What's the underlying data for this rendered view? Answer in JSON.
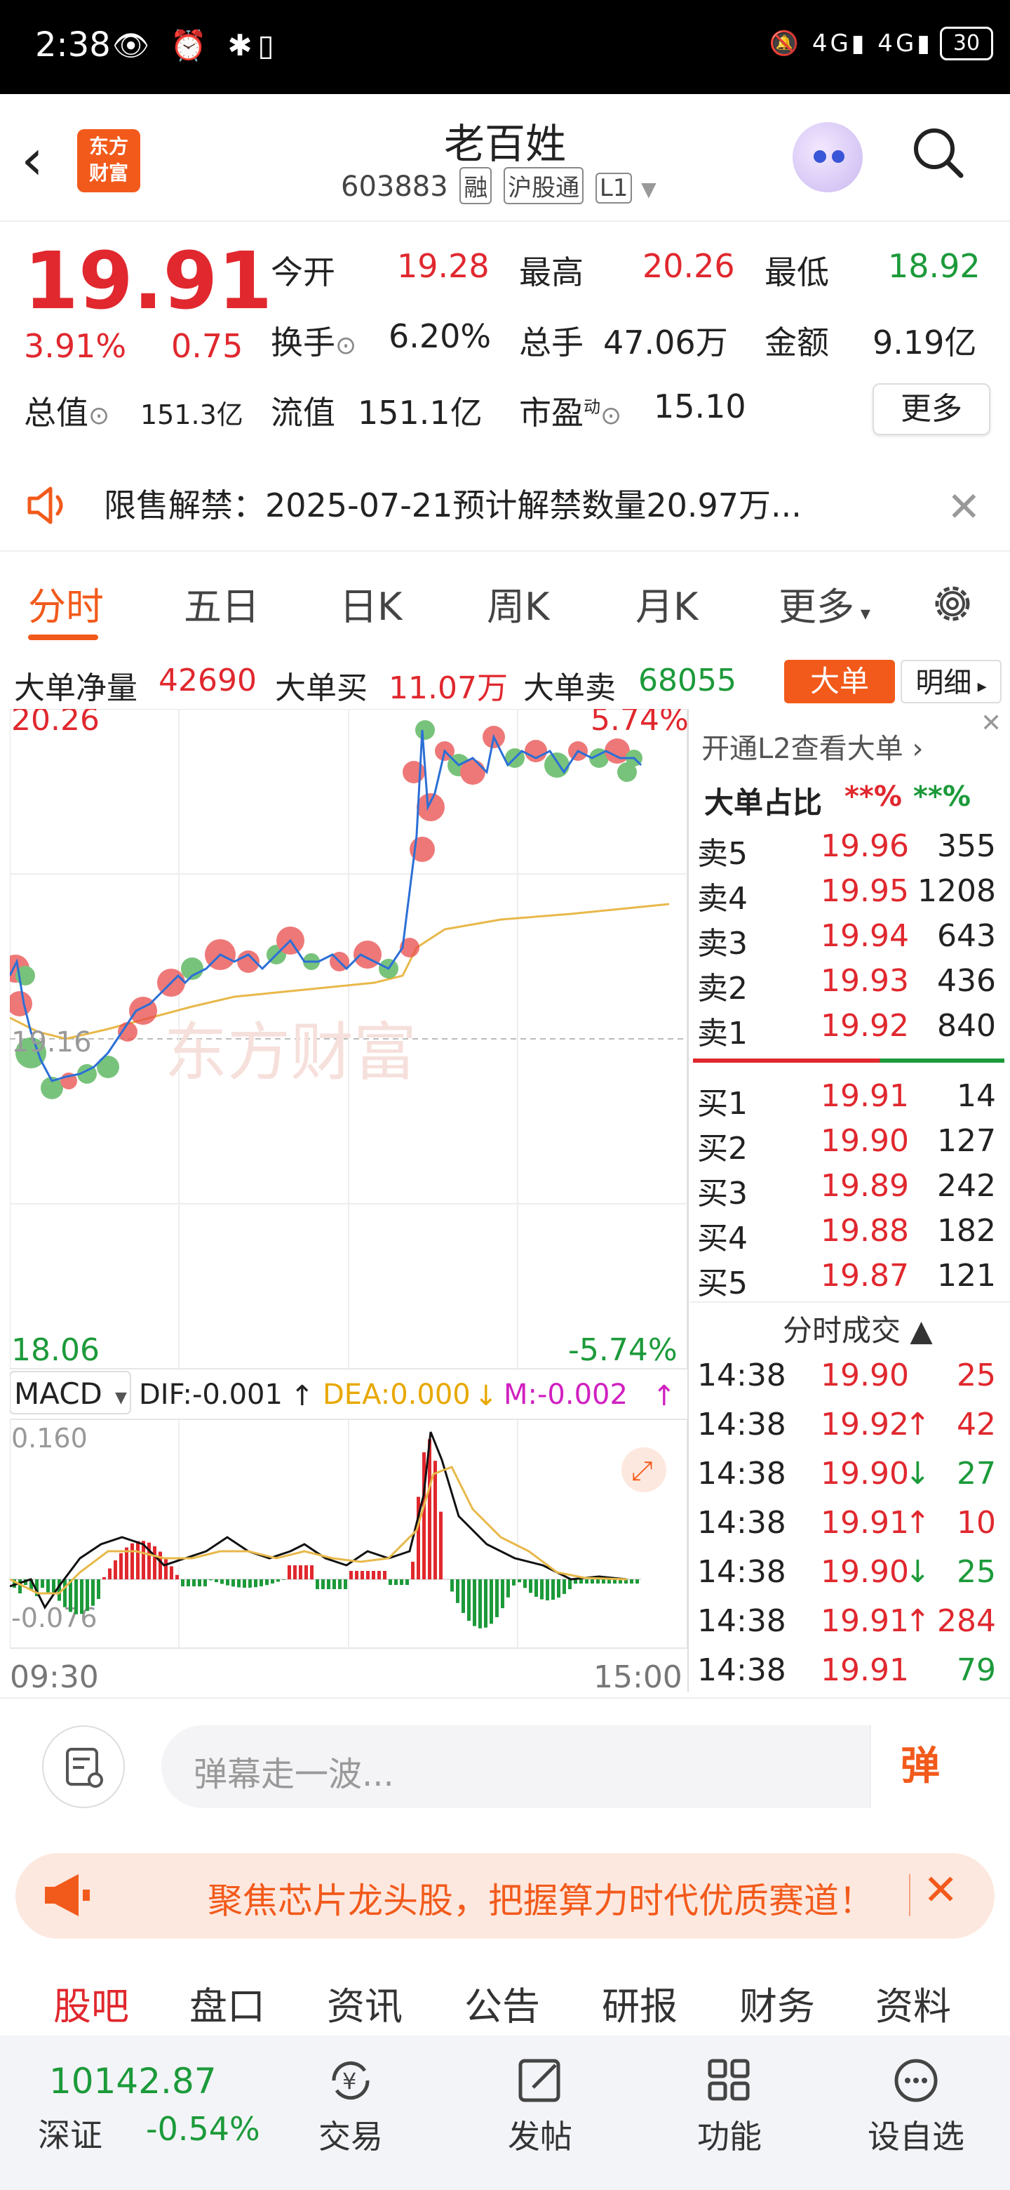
{
  "status_bar": {
    "time": "2:38",
    "left_icons": "👁 ⏰ ✱▯",
    "right_icons": "🔕 4G▮ 4G▮",
    "battery": "30"
  },
  "header": {
    "stock_name": "老百姓",
    "stock_code": "603883",
    "tags": [
      "融",
      "沪股通",
      "L1"
    ],
    "logo_text_line1": "东方",
    "logo_text_line2": "财富"
  },
  "quote": {
    "price": "19.91",
    "change_pct": "3.91%",
    "change": "0.75",
    "open_label": "今开",
    "open": "19.28",
    "high_label": "最高",
    "high": "20.26",
    "low_label": "最低",
    "low": "18.92",
    "turnover_label": "换手",
    "turnover": "6.20%",
    "volume_label": "总手",
    "volume": "47.06万",
    "amount_label": "金额",
    "amount": "9.19亿",
    "total_cap_label": "总值",
    "total_cap": "151.3亿",
    "float_cap_label": "流值",
    "float_cap": "151.1亿",
    "pe_label": "市盈",
    "pe_sup": "动",
    "pe": "15.10",
    "more_label": "更多"
  },
  "notice": {
    "text": "限售解禁：2025-07-21预计解禁数量20.97万..."
  },
  "tabs": [
    "分时",
    "五日",
    "日K",
    "周K",
    "月K",
    "更多"
  ],
  "bigorder": {
    "net_label": "大单净量",
    "net": "42690",
    "buy_label": "大单买",
    "buy": "11.07万",
    "sell_label": "大单卖",
    "sell": "68055",
    "btn_big": "大单",
    "btn_detail": "明细"
  },
  "chart_labels": {
    "top_price": "20.26",
    "top_pct": "5.74%",
    "bottom_price": "18.06",
    "bottom_pct": "-5.74%",
    "mid_price": "19.16",
    "start_time": "09:30",
    "end_time": "15:00",
    "watermark": "东方财富"
  },
  "macd": {
    "name": "MACD",
    "dif": "DIF:-0.001",
    "dea": "DEA:0.000",
    "m": "M:-0.002",
    "top": "0.160",
    "bottom": "-0.076"
  },
  "colors": {
    "accent": "#f25a1b",
    "up": "#e0282e",
    "down": "#1c9a3a",
    "avg_line": "#e8b84a",
    "price_line": "#2b6fd6"
  },
  "orderbook": {
    "l2_link": "开通L2查看大单",
    "ratio_label": "大单占比",
    "ratio_buy": "**%",
    "ratio_sell": "**%",
    "asks": [
      {
        "label": "卖5",
        "price": "19.96",
        "vol": "355"
      },
      {
        "label": "卖4",
        "price": "19.95",
        "vol": "1208"
      },
      {
        "label": "卖3",
        "price": "19.94",
        "vol": "643"
      },
      {
        "label": "卖2",
        "price": "19.93",
        "vol": "436"
      },
      {
        "label": "卖1",
        "price": "19.92",
        "vol": "840"
      }
    ],
    "bids": [
      {
        "label": "买1",
        "price": "19.91",
        "vol": "14"
      },
      {
        "label": "买2",
        "price": "19.90",
        "vol": "127"
      },
      {
        "label": "买3",
        "price": "19.89",
        "vol": "242"
      },
      {
        "label": "买4",
        "price": "19.88",
        "vol": "182"
      },
      {
        "label": "买5",
        "price": "19.87",
        "vol": "121"
      }
    ],
    "trades_label": "分时成交",
    "trades": [
      {
        "time": "14:38",
        "price": "19.90",
        "arrow": "",
        "vol": "25",
        "dir": "up"
      },
      {
        "time": "14:38",
        "price": "19.92",
        "arrow": "↑",
        "vol": "42",
        "dir": "up"
      },
      {
        "time": "14:38",
        "price": "19.90",
        "arrow": "↓",
        "vol": "27",
        "dir": "down"
      },
      {
        "time": "14:38",
        "price": "19.91",
        "arrow": "↑",
        "vol": "10",
        "dir": "up"
      },
      {
        "time": "14:38",
        "price": "19.90",
        "arrow": "↓",
        "vol": "25",
        "dir": "down"
      },
      {
        "time": "14:38",
        "price": "19.91",
        "arrow": "↑",
        "vol": "284",
        "dir": "up"
      },
      {
        "time": "14:38",
        "price": "19.91",
        "arrow": "",
        "vol": "79",
        "dir": "down"
      }
    ]
  },
  "comment": {
    "placeholder": "弹幕走一波...",
    "danmu": "弹"
  },
  "promo": {
    "text": "聚焦芯片龙头股，把握算力时代优质赛道！"
  },
  "bottom_tabs": [
    "股吧",
    "盘口",
    "资讯",
    "公告",
    "研报",
    "财务",
    "资料"
  ],
  "bottom_nav": {
    "index_value": "10142.87",
    "index_name": "深证",
    "index_change": "-0.54%",
    "items": [
      {
        "label": "交易",
        "icon": "yen-refresh-icon"
      },
      {
        "label": "发帖",
        "icon": "edit-icon"
      },
      {
        "label": "功能",
        "icon": "grid-icon"
      },
      {
        "label": "设自选",
        "icon": "more-dots-icon"
      }
    ]
  }
}
